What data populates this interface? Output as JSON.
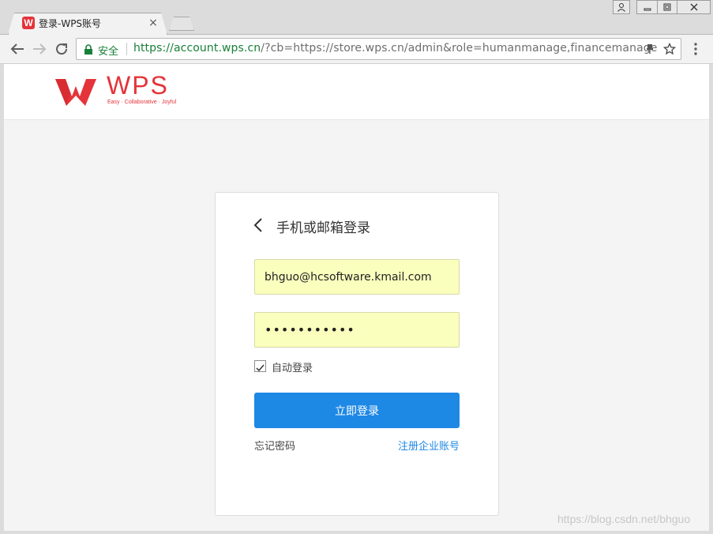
{
  "browser": {
    "tab": {
      "favicon_glyph": "W",
      "title": "登录-WPS账号",
      "close_glyph": "×"
    },
    "window_buttons": {
      "user_glyph": "👤",
      "minimize_glyph": "–",
      "restore_glyph": "◻",
      "close_glyph": "✕"
    },
    "address_bar": {
      "secure_label": "安全",
      "url_host": "https://account.wps.cn",
      "url_rest": "/?cb=https://store.wps.cn/admin&role=humanmanage,financemanage"
    },
    "icons": {
      "back": "back-arrow-icon",
      "forward": "forward-arrow-icon",
      "reload": "reload-icon",
      "lock": "lock-icon",
      "pin": "pin-icon",
      "star": "star-icon",
      "menu": "kebab-menu-icon"
    }
  },
  "header": {
    "logo_text": "WPS",
    "tagline": "Easy · Collaborative · Joyful"
  },
  "login": {
    "title": "手机或邮箱登录",
    "email_value": "bhguo@hcsoftware.kmail.com",
    "password_value": "•••••••••••",
    "auto_login_label": "自动登录",
    "auto_login_checked": true,
    "submit_label": "立即登录",
    "forgot_label": "忘记密码",
    "register_label": "注册企业账号"
  },
  "watermark": "https://blog.csdn.net/bhguo",
  "colors": {
    "brand_red": "#e5333a",
    "primary_blue": "#1e88e5",
    "secure_green": "#188038",
    "autofill_yellow": "#faffbd"
  }
}
